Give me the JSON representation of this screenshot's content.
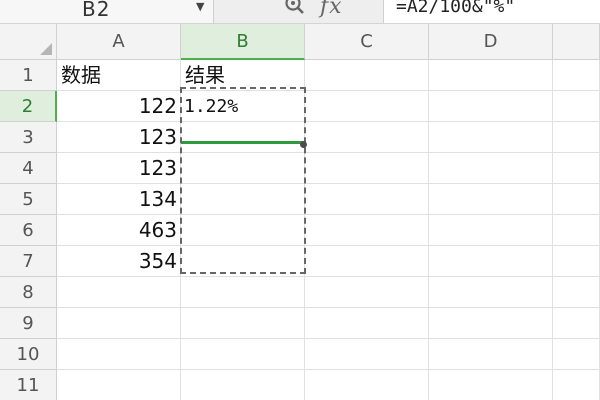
{
  "formula_bar": {
    "name_box": "B2",
    "fx_label": "fx",
    "formula": "=A2/100&\"%\""
  },
  "columns": [
    "A",
    "B",
    "C",
    "D"
  ],
  "rows": [
    "1",
    "2",
    "3",
    "4",
    "5",
    "6",
    "7",
    "8",
    "9",
    "10",
    "11"
  ],
  "cells": {
    "A1": "数据",
    "B1": "结果",
    "A2": "122",
    "B2": "1.22%",
    "A3": "123",
    "A4": "123",
    "A5": "134",
    "A6": "463",
    "A7": "354"
  },
  "colors": {
    "selection_green": "#4caf50",
    "header_bg": "#f3f3f3",
    "selected_header_bg": "#dfeedd"
  },
  "icons": {
    "zoom": "magnifier-icon",
    "dropdown": "chevron-down-icon"
  }
}
